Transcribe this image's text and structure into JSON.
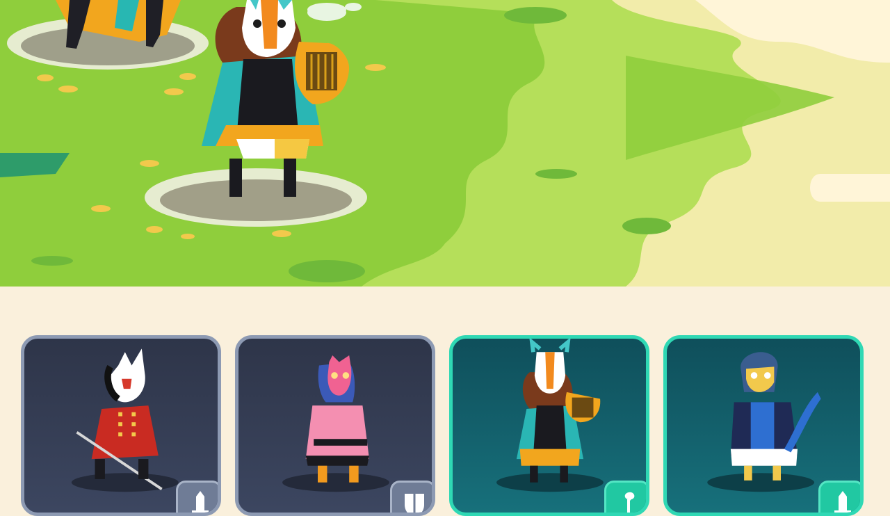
{
  "scene": {
    "name": "battlefield",
    "colors": {
      "grass": "#8fce3c",
      "light_grass": "#b8e05a",
      "sand": "#f4eeb0",
      "cloud": "#fff4d6"
    }
  },
  "roster": {
    "cards": [
      {
        "hero": "fox-mask-swordsman",
        "role_icon": "sword-icon",
        "frame": "gray",
        "selected": false
      },
      {
        "hero": "pink-bear-guardian",
        "role_icon": "shield-icon",
        "frame": "gray",
        "selected": false
      },
      {
        "hero": "harp-bard",
        "role_icon": "staff-icon",
        "frame": "teal",
        "selected": true
      },
      {
        "hero": "blue-owl-archer",
        "role_icon": "sword-icon",
        "frame": "teal",
        "selected": true
      }
    ]
  },
  "colors": {
    "background": "#faf0dc",
    "gray_frame": "#8d9ab3",
    "teal_frame": "#2fd8b4"
  }
}
